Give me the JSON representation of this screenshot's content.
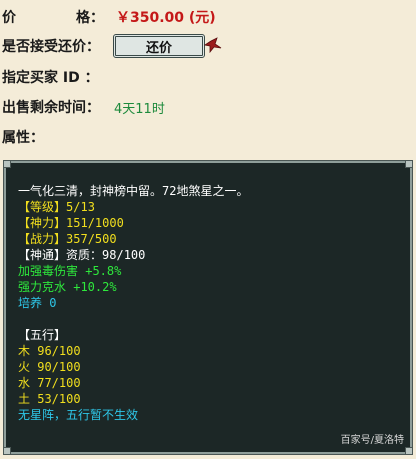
{
  "price": {
    "label_a": "价",
    "label_b": "格：",
    "value": "￥350.00 (元)"
  },
  "accept": {
    "label": "是否接受还价：",
    "button": "还价"
  },
  "buyer": {
    "label": "指定买家 ID  ："
  },
  "time": {
    "label": "出售剩余时间：",
    "value": "4天11时"
  },
  "attributes": {
    "label": "属性："
  },
  "detail": {
    "description": "一气化三清，封神榜中留。72地煞星之一。",
    "level": {
      "label": "【等级】",
      "value": "5/13"
    },
    "spirit": {
      "label": "【神力】",
      "value": "151/1000"
    },
    "combat": {
      "label": "【战力】",
      "value": "357/500"
    },
    "divine": {
      "label": "【神通】",
      "value": "资质：98/100"
    },
    "bonus_1": "加强毒伤害 +5.8%",
    "bonus_2": "强力克水 +10.2%",
    "cultivate": "培养 0",
    "five_elements_header": "【五行】",
    "elements": [
      "木 96/100",
      "火 90/100",
      "水 77/100",
      "土 53/100"
    ],
    "no_formation": "无星阵，五行暂不生效"
  },
  "watermark": "百家号/夏洛特",
  "colors": {
    "price": "#c41818",
    "time": "#1d8a3c",
    "panel_bg": "#1c2726",
    "yellow": "#f2df1e",
    "green": "#2ee83c",
    "cyan": "#2ec7e8"
  }
}
